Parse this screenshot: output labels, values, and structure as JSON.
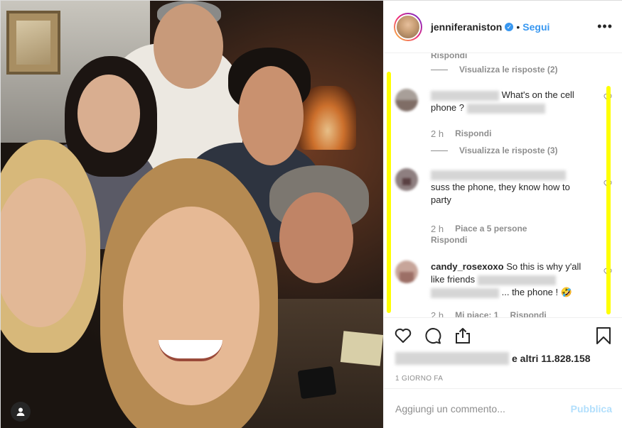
{
  "post": {
    "username": "jenniferaniston",
    "follow_label": "Segui",
    "separator": "•",
    "more_label": "•••"
  },
  "comments": {
    "top_reply_label": "Rispondi",
    "top_view_replies": "Visualizza le risposte (2)",
    "items": [
      {
        "text_a": "What's on the cell",
        "text_b": "phone ?",
        "time": "2 h",
        "reply": "Rispondi",
        "view_replies": "Visualizza le risposte (3)"
      },
      {
        "text": "suss the phone, they know how to party",
        "time": "2 h",
        "likes": "Piace a 5 persone",
        "reply": "Rispondi"
      },
      {
        "author": "candy_rosexoxo",
        "text_a": "So this is why y'all like friends",
        "text_b": "... the phone ! 🤣",
        "time": "2 h",
        "likes": "Mi piace: 1",
        "reply": "Rispondi"
      }
    ]
  },
  "likes": {
    "suffix": "e altri 11.828.158"
  },
  "date": "1 GIORNO FA",
  "add_comment": {
    "placeholder": "Aggiungi un commento...",
    "publish": "Pubblica"
  },
  "colors": {
    "link_blue": "#3897f0",
    "highlight": "#ffff00"
  }
}
